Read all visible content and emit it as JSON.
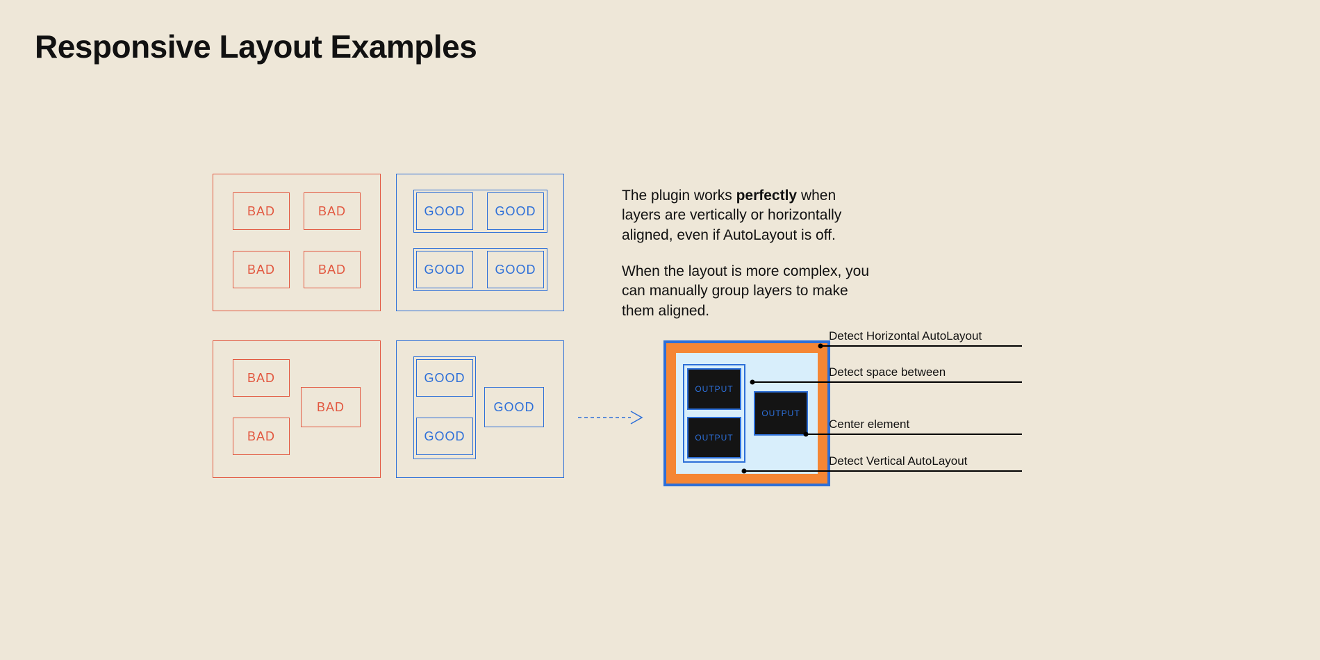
{
  "title": "Responsive Layout Examples",
  "labels": {
    "bad": "BAD",
    "good": "GOOD",
    "output": "OUTPUT"
  },
  "description": {
    "p1_pre": "The plugin works ",
    "p1_bold": "perfectly",
    "p1_post": " when layers are vertically or horizontally aligned, even if AutoLayout is off.",
    "p2": "When the layout is more complex, you can manually group layers to make them aligned."
  },
  "annotations": {
    "horiz": "Detect Horizontal AutoLayout",
    "space": "Detect space between",
    "center": "Center element",
    "vert": "Detect Vertical AutoLayout"
  },
  "colors": {
    "bad": "#E2573F",
    "good": "#2D6FD8",
    "accent": "#F58634",
    "light": "#D8EEFB"
  }
}
